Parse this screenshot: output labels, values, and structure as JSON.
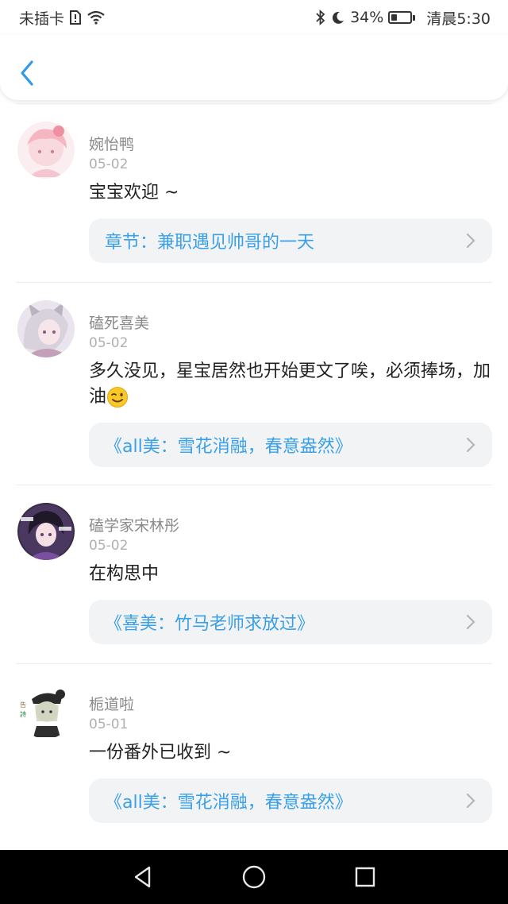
{
  "status_bar": {
    "carrier": "未插卡",
    "battery_percent": "34%",
    "battery_level": 0.34,
    "time": "清晨5:30"
  },
  "header": {
    "back_icon": "chevron-left-icon"
  },
  "comments": [
    {
      "name": "婉怡鸭",
      "date": "05-02",
      "text": "宝宝欢迎 ~",
      "chapter": "章节：兼职遇见帅哥的一天"
    },
    {
      "name": "磕死喜美",
      "date": "05-02",
      "text": "多久没见，星宝居然也开始更文了唉，必须捧场，加油",
      "emoji": "winking-face",
      "chapter": "《all美：雪花消融，春意盎然》"
    },
    {
      "name": "磕学家宋林彤",
      "date": "05-02",
      "text": "在构思中",
      "chapter": "《喜美：竹马老师求放过》"
    },
    {
      "name": "栀道啦",
      "date": "05-01",
      "text": "一份番外已收到 ~",
      "chapter": "《all美：雪花消融，春意盎然》"
    }
  ],
  "colors": {
    "accent": "#3aa0e8",
    "chapter_bg": "#f2f3f5",
    "nav_bg": "#000000"
  }
}
